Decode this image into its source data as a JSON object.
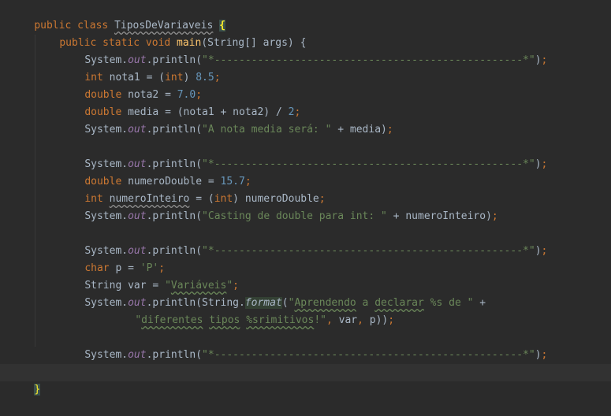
{
  "code": {
    "l1": [
      "public class ",
      "TiposDeVariaveis",
      " ",
      "{"
    ],
    "l2": [
      "public static void ",
      "main",
      "(String[] args) {"
    ],
    "l3": [
      "System.",
      "out",
      ".println(",
      "\"*--------------------------------------------------*\"",
      ")",
      ";"
    ],
    "l4": [
      "int ",
      "nota1 = (",
      "int",
      ") ",
      "8.5",
      ";"
    ],
    "l5": [
      "double ",
      "nota2 = ",
      "7.0",
      ";"
    ],
    "l6": [
      "double ",
      "media = (nota1 + nota2) / ",
      "2",
      ";"
    ],
    "l7": [
      "System.",
      "out",
      ".println(",
      "\"A nota media será: \"",
      " + media)",
      ";"
    ],
    "l9": [
      "System.",
      "out",
      ".println(",
      "\"*--------------------------------------------------*\"",
      ")",
      ";"
    ],
    "l10": [
      "double ",
      "numeroDouble = ",
      "15.7",
      ";"
    ],
    "l11": [
      "int ",
      "numeroInteiro",
      " = (",
      "int",
      ") numeroDouble",
      ";"
    ],
    "l12": [
      "System.",
      "out",
      ".println(",
      "\"Casting de double para int: \"",
      " + numeroInteiro)",
      ";"
    ],
    "l14": [
      "System.",
      "out",
      ".println(",
      "\"*--------------------------------------------------*\"",
      ")",
      ";"
    ],
    "l15": [
      "char ",
      "p = ",
      "'P'",
      ";"
    ],
    "l16": [
      "String var = ",
      "\"",
      "Variáveis",
      "\"",
      ";"
    ],
    "l17": [
      "System.",
      "out",
      ".println(String.",
      "format",
      "(",
      "\"",
      "Aprendendo",
      " a ",
      "declarar",
      " %s de \"",
      " +"
    ],
    "l18": [
      "\"",
      "diferentes",
      " ",
      "tipos",
      " ",
      "%srimitivos",
      "!\"",
      ", ",
      "var",
      ", ",
      "p))",
      ";"
    ],
    "l20": [
      "System.",
      "out",
      ".println(",
      "\"*--------------------------------------------------*\"",
      ")",
      ";"
    ],
    "l21": [
      "}"
    ],
    "l22": [
      "}"
    ]
  },
  "colors": {
    "background": "#2b2b2b",
    "current_line": "#323232",
    "keyword": "#cc7832",
    "string": "#6a8759",
    "number": "#6897bb",
    "method_decl": "#ffc66d",
    "static_field": "#9876aa",
    "default_text": "#a9b7c6"
  }
}
